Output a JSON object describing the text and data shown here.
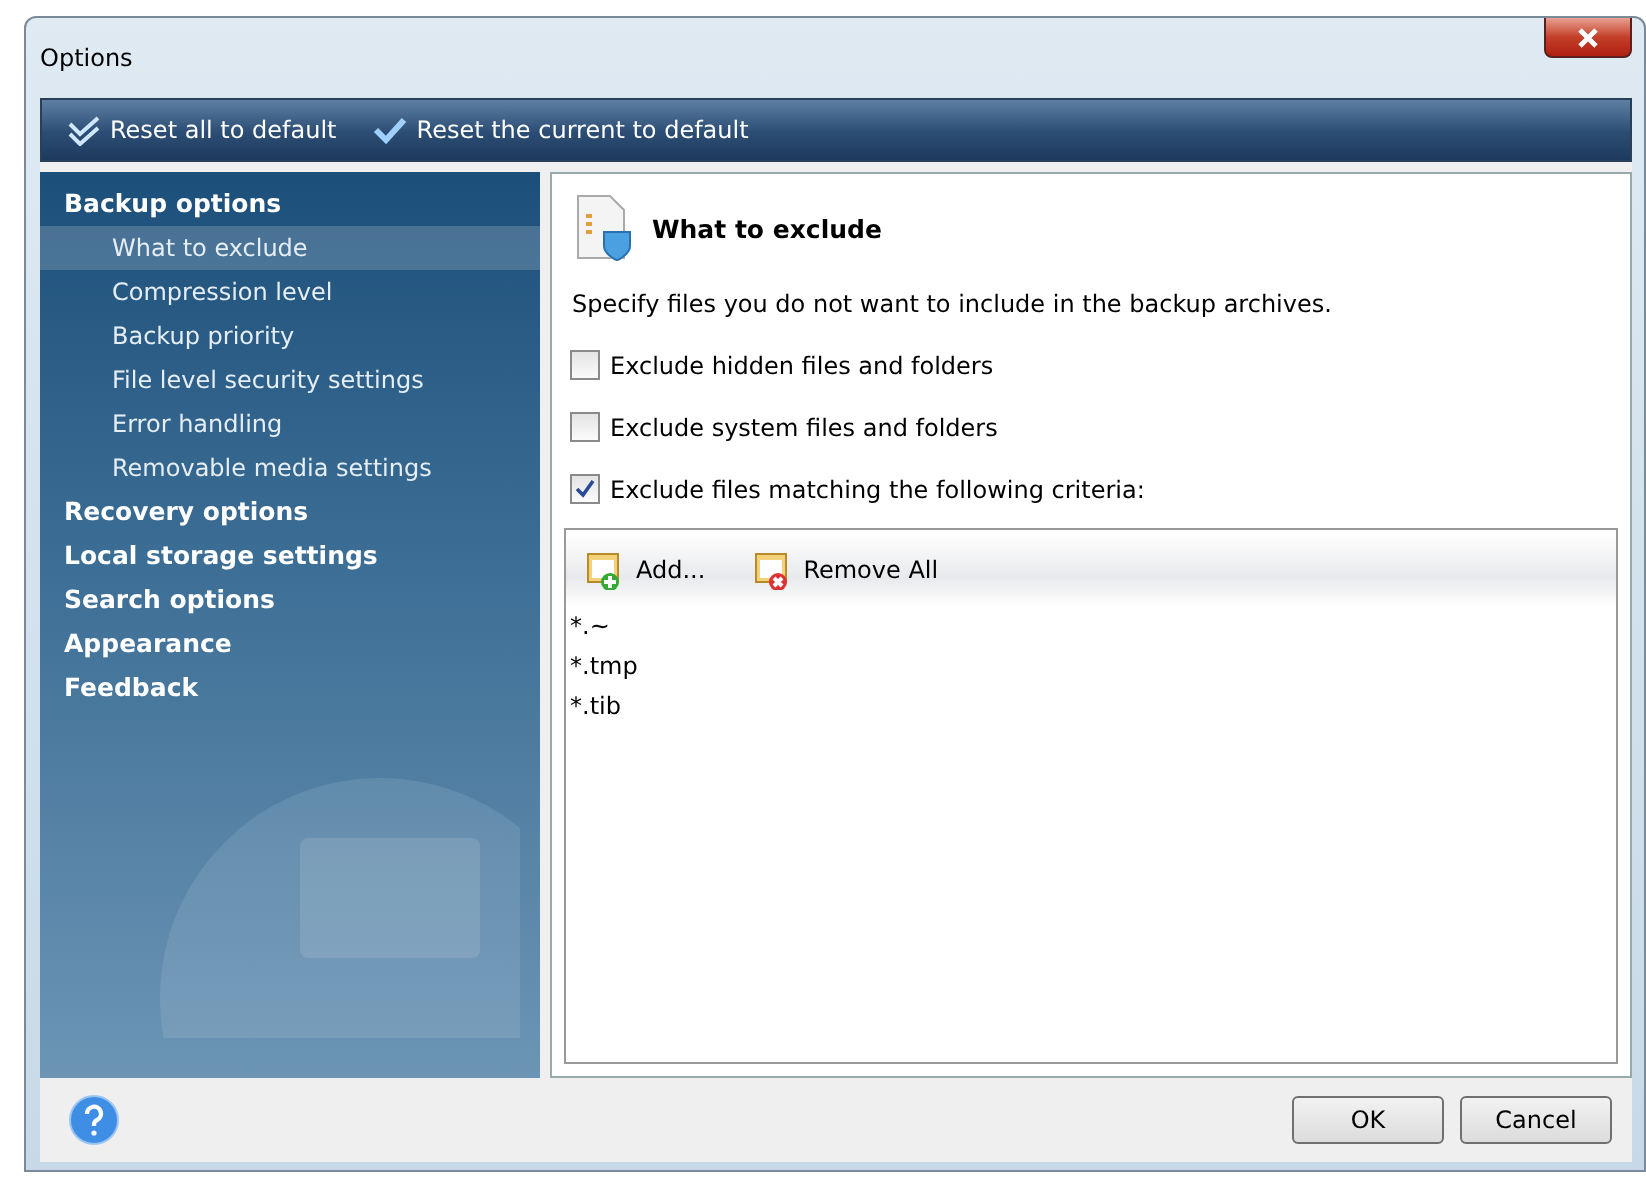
{
  "window": {
    "title": "Options"
  },
  "toolbar": [
    {
      "kind": "reset-all",
      "label": "Reset all to default"
    },
    {
      "kind": "reset-current",
      "label": "Reset the current to default"
    }
  ],
  "sidebar": {
    "items": [
      {
        "label": "Backup options",
        "selected": false,
        "children": [
          {
            "label": "What to exclude",
            "selected": true
          },
          {
            "label": "Compression level",
            "selected": false
          },
          {
            "label": "Backup priority",
            "selected": false
          },
          {
            "label": "File level security settings",
            "selected": false
          },
          {
            "label": "Error handling",
            "selected": false
          },
          {
            "label": "Removable media settings",
            "selected": false
          }
        ]
      },
      {
        "label": "Recovery options",
        "selected": false
      },
      {
        "label": "Local storage settings",
        "selected": false
      },
      {
        "label": "Search options",
        "selected": false
      },
      {
        "label": "Appearance",
        "selected": false
      },
      {
        "label": "Feedback",
        "selected": false
      }
    ]
  },
  "panel": {
    "title": "What to exclude",
    "description": "Specify files you do not want to include in the backup archives.",
    "options": [
      {
        "label": "Exclude hidden files and folders",
        "checked": false
      },
      {
        "label": "Exclude system files and folders",
        "checked": false
      },
      {
        "label": "Exclude files matching the following criteria:",
        "checked": true
      }
    ],
    "list_toolbar": [
      {
        "kind": "add",
        "label": "Add..."
      },
      {
        "kind": "remove",
        "label": "Remove All"
      }
    ],
    "criteria": [
      "*.~",
      "*.tmp",
      "*.tib"
    ]
  },
  "buttons": [
    "OK",
    "Cancel"
  ]
}
